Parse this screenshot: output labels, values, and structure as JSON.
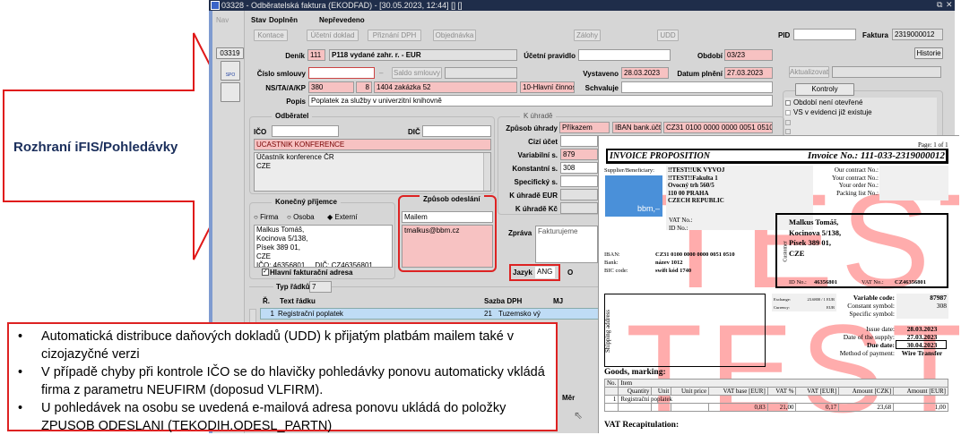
{
  "slide": {
    "arrow_label": "Rozhraní iFIS/Pohledávky",
    "bullets": [
      "Automatická distribuce daňových dokladů (UDD) k přijatým platbám mailem také v cizojazyčné verzi",
      "V případě chyby při kontrole IČO se do hlavičky pohledávky ponovu automaticky vkládá firma z parametru NEUFIRM (doposud VLFIRM).",
      "U pohledávek na osobu se uvedená e-mailová adresa ponovu ukládá do položky ZPUSOB ODESLANI (TEKODIH.ODESL_PARTN)"
    ]
  },
  "window": {
    "title": "03328 - Odběratelská faktura (EKODFAD) - [30.05.2023, 12:44] [] []",
    "nav": "Nav",
    "nav_code": "03319",
    "icon_spo": "SPO"
  },
  "status": {
    "label": "Stav",
    "value": "Doplněn",
    "transfer": "Nepřevedeno"
  },
  "toolbar": [
    "Kontace",
    "Účetní doklad",
    "Přiznání DPH",
    "Objednávka",
    "Zálohy",
    "UDD"
  ],
  "header": {
    "pid_label": "PID",
    "pid": "",
    "faktura_label": "Faktura",
    "faktura": "2319000012",
    "historie": "Historie",
    "denik_label": "Deník",
    "denik": "111",
    "denik_name": "P118 vydané zahr. r. - EUR",
    "ucetni_pravidlo_label": "Účetní pravidlo",
    "ucetni_pravidlo": "",
    "obdobi_label": "Období",
    "obdobi": "03/23",
    "cislo_smlouvy_label": "Číslo smlouvy",
    "cislo_smlouvy": "",
    "dash": "–",
    "saldo_smlouvy": "Saldo smlouvy",
    "vystaveno_label": "Vystaveno",
    "vystaveno": "28.03.2023",
    "datum_plneni_label": "Datum plnění",
    "datum_plneni": "27.03.2023",
    "aktualizovat": "Aktualizovat",
    "ns_label": "NS/TA/A/KP",
    "ns": "380",
    "ta": "8",
    "a": "1404 zakázka 52",
    "kp": "10-Hlavní činnost",
    "schvaluje_label": "Schvaluje",
    "schvaluje": "",
    "popis_label": "Popis",
    "popis": "Poplatek za služby v univerzitní knihovně"
  },
  "kontroly": {
    "button": "Kontroly",
    "items": [
      "Období není otevřené",
      "VS v evidenci již existuje"
    ]
  },
  "odberatel": {
    "title": "Odběratel",
    "ico_label": "IČO",
    "ico": "",
    "dic_label": "DIČ",
    "dic": "",
    "name": "UCASTNIK KONFERENCE",
    "address": "Účastník konference ČR\nCZE"
  },
  "k_uhrade": {
    "title": "K úhradě",
    "zpusob_label": "Způsob úhrady",
    "zpusob": "Příkazem",
    "iban_label": "IBAN bank.účtu",
    "iban": "CZ31 0100 0000 0000 0051 0510",
    "cizi_ucet_label": "Cizí účet",
    "variabilni_label": "Variabilní s.",
    "variabilni": "879",
    "konstantni_label": "Konstantní s.",
    "konstantni": "308",
    "specificky_label": "Specifický s.",
    "eur_label": "K úhradě  EUR",
    "kc_label": "K úhradě Kč"
  },
  "prijemce": {
    "title": "Konečný příjemce",
    "radios": [
      "Firma",
      "Osoba",
      "Externí"
    ],
    "selected": "Externí",
    "address": "Malkus Tomáš,\nKocinova 5/138,\nPísek 389 01,\nCZE\nIČO: 46356801     DIČ: CZ46356801",
    "hlavni": "Hlavní fakturační adresa"
  },
  "odeslani": {
    "title": "Způsob odeslání",
    "method": "Mailem",
    "email": "tmalkus@bbm.cz"
  },
  "zprava": {
    "label": "Zpráva",
    "value": "Fakturujeme",
    "jazyk_label": "Jazyk",
    "jazyk": "ANG",
    "o": "O"
  },
  "lines": {
    "typ_label": "Typ řádků",
    "typ": "7",
    "headers": [
      "Ř.",
      "Text řádku",
      "Sazba DPH",
      "MJ"
    ],
    "row": {
      "n": "1",
      "text": "Registrační poplatek",
      "rate": "21",
      "type": "Tuzemsko vý"
    },
    "mena": "Měr"
  },
  "invoice": {
    "page": "Page: 1 of 1",
    "title": "INVOICE PROPOSITION",
    "number": "Invoice No.: 111-033-2319000012",
    "supplier_label": "Supplier/Beneficiary:",
    "supplier": [
      "!!TEST!!UK VYVOJ",
      "!!TEST!!Fakulta 1",
      "Ovocný trh 560/5",
      "110 00 PRAHA",
      "CZECH REPUBLIC"
    ],
    "logo": "bbm,–",
    "vat_no": "VAT No.:",
    "id_no": "ID No.:",
    "refs": [
      "Our contract No.:",
      "Your contract No.:",
      "Your order No.:",
      "Packing list No.:"
    ],
    "customer_label": "Customer",
    "customer": [
      "Malkus Tomáš,",
      "Kocinova 5/138,",
      "Písek 389 01,",
      "CZE"
    ],
    "cust_id_label": "ID No.:",
    "cust_id": "46356801",
    "cust_vat_label": "VAT No.:",
    "cust_vat": "CZ46356801",
    "iban_label": "IBAN:",
    "iban": "CZ31 0100 0000 0000 0051 0510",
    "bank_label": "Bank:",
    "bank": "název 1012",
    "bic_label": "BIC code:",
    "bic": "swift kód 1740",
    "shipping": "Shipping address",
    "exchange_label": "Exchange:",
    "exchange": "23.6800 / 1 EUR",
    "currency_label": "Currency:",
    "currency": "EUR",
    "vc_label": "Variable code:",
    "vc": "87987",
    "cs_label": "Constant symbol:",
    "cs": "308",
    "ss_label": "Specific symbol:",
    "issue_label": "Issue date:",
    "issue": "28.03.2023",
    "supply_label": "Date of the supply:",
    "supply": "27.03.2023",
    "due_label": "Due date:",
    "due": "30.04.2023",
    "method_label": "Method of payment:",
    "method": "Wire Transfer",
    "goods": "Goods, marking:",
    "cols1": [
      "No.",
      "Item"
    ],
    "cols2": [
      "Quantity",
      "Unit",
      "Unit price",
      "VAT base [EUR]",
      "VAT %",
      "VAT [EUR]",
      "Amount [CZK]",
      "Amount [EUR]"
    ],
    "item": [
      "1",
      "Registrační poplatek"
    ],
    "values": [
      "",
      "",
      "",
      "0,83",
      "21,00",
      "0,17",
      "23,68",
      "1,00"
    ],
    "vat_recap": "VAT Recapitulation:",
    "watermark": "TEST"
  }
}
